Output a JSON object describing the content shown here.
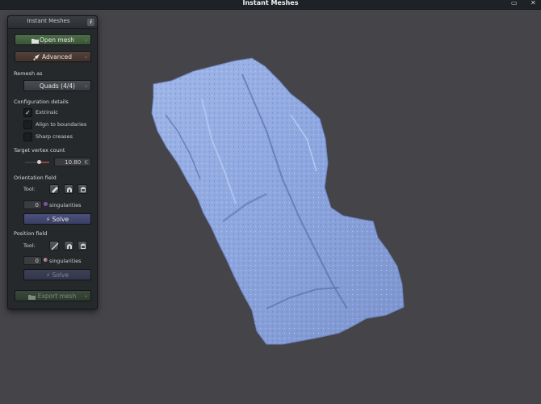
{
  "window": {
    "title": "Instant Meshes",
    "controls": {
      "close_label": "✕",
      "maximize_label": "▭"
    }
  },
  "panel": {
    "title": "Instant Meshes",
    "info_label": "i",
    "open_mesh_label": "Open mesh",
    "advanced_label": "Advanced",
    "remesh": {
      "label": "Remesh as",
      "value": "Quads (4/4)"
    },
    "config": {
      "label": "Configuration details",
      "extrinsic": {
        "label": "Extrinsic",
        "checked": true
      },
      "align_boundaries": {
        "label": "Align to boundaries",
        "checked": false
      },
      "sharp_creases": {
        "label": "Sharp creases",
        "checked": false
      }
    },
    "target_vertex": {
      "label": "Target vertex count",
      "value": "10.80",
      "unit": "K"
    },
    "orientation": {
      "label": "Orientation field",
      "tool_label": "Tool:",
      "singularities_value": "0",
      "singularities_label": "singularities",
      "solve_label": "Solve",
      "bolt": "⚡"
    },
    "position": {
      "label": "Position field",
      "tool_label": "Tool:",
      "singularities_value": "0",
      "singularities_label": "singularities",
      "solve_label": "Solve",
      "bolt": "⚡"
    },
    "export_label": "Export mesh",
    "chevron": "›"
  },
  "colors": {
    "background": "#444449",
    "mesh": "#8ea8e0",
    "accent_green": "#4d6e49",
    "accent_blue": "#4c517d"
  }
}
